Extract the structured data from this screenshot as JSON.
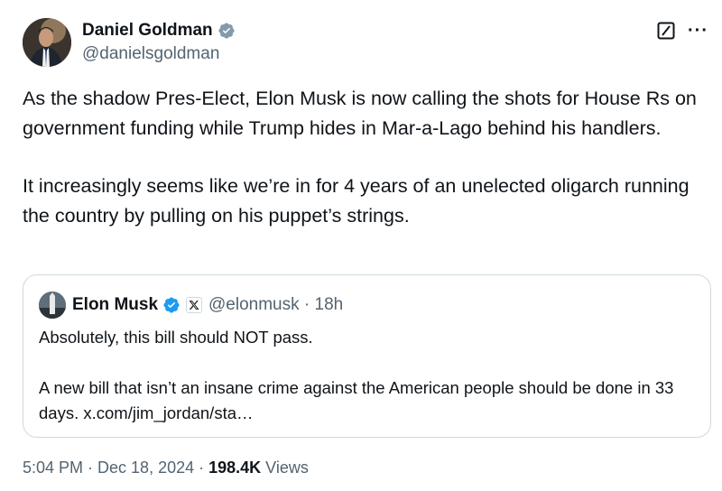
{
  "author": {
    "display_name": "Daniel Goldman",
    "handle": "@danielsgoldman",
    "verified_badge_color": "#829aab"
  },
  "header_icons": {
    "grok": "grok-icon",
    "more": "more-icon",
    "more_glyph": "···"
  },
  "tweet": {
    "paragraph_1": "As the shadow Pres-Elect, Elon Musk is now calling the shots for House Rs on government funding while Trump hides in Mar-a-Lago behind his handlers.",
    "paragraph_2": "It increasingly seems like we’re in for 4 years of an unelected oligarch running the country by pulling on his puppet’s strings."
  },
  "quote": {
    "display_name": "Elon Musk",
    "verified_badge_color": "#1d9bf0",
    "affiliate_badge": "x-logo-icon",
    "handle_time": "@elonmusk · 18h",
    "paragraph_1": "Absolutely, this bill should NOT pass.",
    "paragraph_2": "A new bill that isn’t an insane crime against the American people should be done in 33 days. x.com/jim_jordan/sta…"
  },
  "meta": {
    "timestamp": "5:04 PM · Dec 18, 2024 · ",
    "views_count": "198.4K",
    "views_label": " Views"
  }
}
